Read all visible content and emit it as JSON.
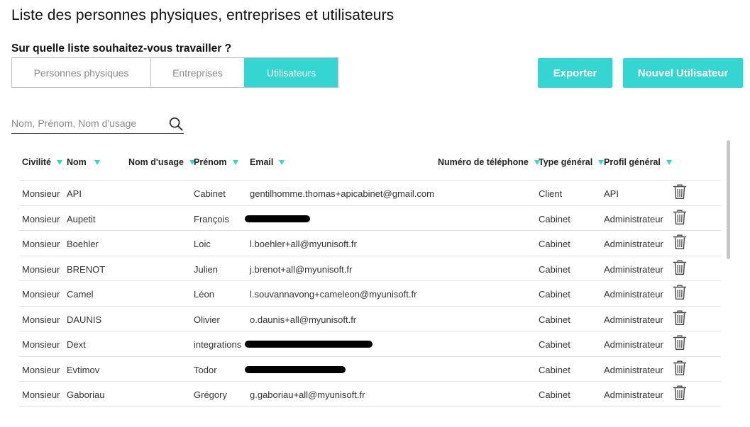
{
  "page": {
    "title": "Liste des personnes physiques, entreprises et utilisateurs",
    "question": "Sur quelle liste souhaitez-vous travailler ?"
  },
  "tabs": [
    {
      "label": "Personnes physiques",
      "active": false
    },
    {
      "label": "Entreprises",
      "active": false
    },
    {
      "label": "Utilisateurs",
      "active": true
    }
  ],
  "actions": {
    "export_label": "Exporter",
    "new_user_label": "Nouvel Utilisateur"
  },
  "search": {
    "placeholder": "Nom, Prénom, Nom d'usage",
    "value": ""
  },
  "colors": {
    "accent": "#35d6d2"
  },
  "table": {
    "columns": [
      {
        "label": "Civilité",
        "sortable": true
      },
      {
        "label": "Nom",
        "sortable": true
      },
      {
        "label": "Nom d'usage",
        "sortable": true
      },
      {
        "label": "Prénom",
        "sortable": true
      },
      {
        "label": "Email",
        "sortable": true
      },
      {
        "label": "Numéro de téléphone",
        "sortable": true
      },
      {
        "label": "Type général",
        "sortable": true
      },
      {
        "label": "Profil général",
        "sortable": true
      }
    ],
    "rows": [
      {
        "civilite": "Monsieur",
        "nom": "API",
        "nom_usage": "",
        "prenom": "Cabinet",
        "email": "gentilhomme.thomas+apicabinet@gmail.com",
        "telephone": "",
        "type": "Client",
        "profil": "API",
        "email_redacted": false
      },
      {
        "civilite": "Monsieur",
        "nom": "Aupetit",
        "nom_usage": "",
        "prenom": "François",
        "email": "",
        "telephone": "",
        "type": "Cabinet",
        "profil": "Administrateur",
        "email_redacted": true
      },
      {
        "civilite": "Monsieur",
        "nom": "Boehler",
        "nom_usage": "",
        "prenom": "Loic",
        "email": "l.boehler+all@myunisoft.fr",
        "telephone": "",
        "type": "Cabinet",
        "profil": "Administrateur",
        "email_redacted": false
      },
      {
        "civilite": "Monsieur",
        "nom": "BRENOT",
        "nom_usage": "",
        "prenom": "Julien",
        "email": "j.brenot+all@myunisoft.fr",
        "telephone": "",
        "type": "Cabinet",
        "profil": "Administrateur",
        "email_redacted": false
      },
      {
        "civilite": "Monsieur",
        "nom": "Camel",
        "nom_usage": "",
        "prenom": "Léon",
        "email": "l.souvannavong+cameleon@myunisoft.fr",
        "telephone": "",
        "type": "Cabinet",
        "profil": "Administrateur",
        "email_redacted": false
      },
      {
        "civilite": "Monsieur",
        "nom": "DAUNIS",
        "nom_usage": "",
        "prenom": "Olivier",
        "email": "o.daunis+all@myunisoft.fr",
        "telephone": "",
        "type": "Cabinet",
        "profil": "Administrateur",
        "email_redacted": false
      },
      {
        "civilite": "Monsieur",
        "nom": "Dext",
        "nom_usage": "",
        "prenom": "integrations",
        "email": "",
        "telephone": "",
        "type": "Cabinet",
        "profil": "Administrateur",
        "email_redacted": true
      },
      {
        "civilite": "Monsieur",
        "nom": "Evtimov",
        "nom_usage": "",
        "prenom": "Todor",
        "email": "",
        "telephone": "",
        "type": "Cabinet",
        "profil": "Administrateur",
        "email_redacted": true
      },
      {
        "civilite": "Monsieur",
        "nom": "Gaboriau",
        "nom_usage": "",
        "prenom": "Grégory",
        "email": "g.gaboriau+all@myunisoft.fr",
        "telephone": "",
        "type": "Cabinet",
        "profil": "Administrateur",
        "email_redacted": false
      }
    ]
  }
}
